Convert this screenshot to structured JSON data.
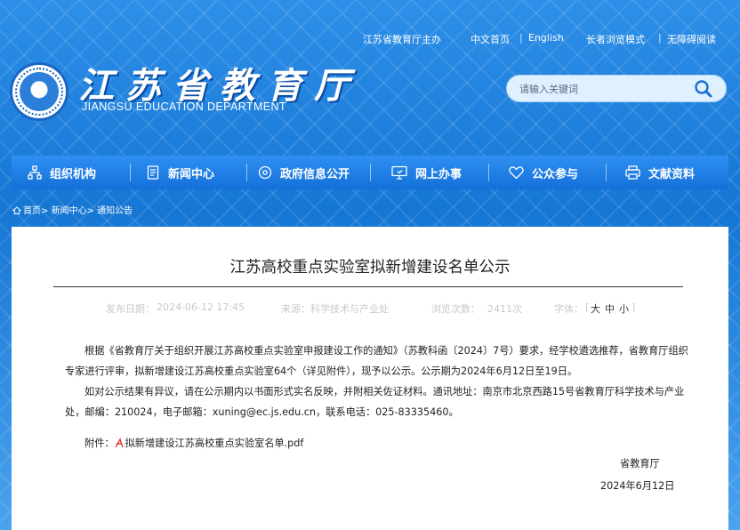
{
  "toplinks": {
    "sponsor": "江苏省教育厅主办",
    "chinese": "中文首页",
    "english": "English",
    "elder": "长者浏览模式",
    "accessible": "无障碍阅读",
    "sep": "|"
  },
  "logo": {
    "title": "江苏省教育厅",
    "subtitle": "JIANGSU EDUCATION DEPARTMENT"
  },
  "search": {
    "placeholder": "请输入关键词",
    "icon": "search-icon"
  },
  "nav": [
    {
      "label": "组织机构",
      "icon": "org-chart-icon"
    },
    {
      "label": "新闻中心",
      "icon": "document-icon"
    },
    {
      "label": "政府信息公开",
      "icon": "eye-icon"
    },
    {
      "label": "网上办事",
      "icon": "monitor-icon"
    },
    {
      "label": "公众参与",
      "icon": "heart-icon"
    },
    {
      "label": "文献资料",
      "icon": "printer-icon"
    }
  ],
  "breadcrumb": {
    "home": "首页",
    "news": "新闻中心",
    "notice": "通知公告",
    "sep": ">"
  },
  "article": {
    "title": "江苏高校重点实验室拟新增建设名单公示",
    "publish_label": "发布日期：",
    "publish_date": "2024-06-12 17:45",
    "source_label": "来源：",
    "source": "科学技术与产业处",
    "views_label": "浏览次数：",
    "views": "2411次",
    "font_label": "字体：",
    "font_open": "[",
    "font_large": "大",
    "font_medium": "中",
    "font_small": "小",
    "font_close": "]",
    "para1": "根据《省教育厅关于组织开展江苏高校重点实验室申报建设工作的通知》（苏教科函〔2024〕7号）要求，经学校遴选推荐，省教育厅组织专家进行评审，拟新增建设江苏高校重点实验室64个（详见附件），现予以公示。公示期为2024年6月12日至19日。",
    "para2": "如对公示结果有异议，请在公示期内以书面形式实名反映，并附相关佐证材料。通讯地址：南京市北京西路15号省教育厅科学技术与产业处，邮编：210024，电子邮箱：xuning@ec.js.edu.cn，联系电话：025-83335460。",
    "attach_label": "附件：",
    "attach_file": "拟新增建设江苏高校重点实验室名单.pdf",
    "signer": "省教育厅",
    "sign_date": "2024年6月12日"
  }
}
